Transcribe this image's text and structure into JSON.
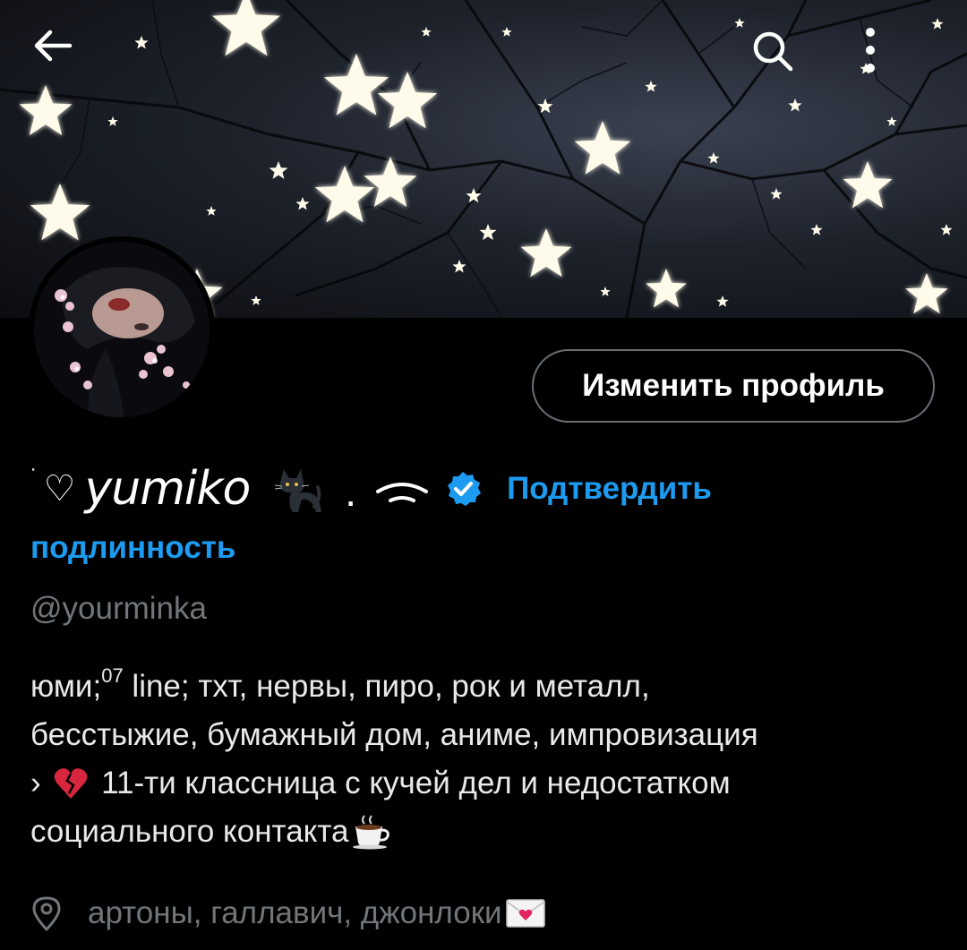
{
  "header": {
    "back_icon": "arrow-left-icon",
    "search_icon": "search-icon",
    "more_icon": "more-vertical-icon"
  },
  "profile": {
    "decor_prefix": "˙",
    "heart": "♡",
    "display_name": "yumiko",
    "name_suffix": ".",
    "handle": "@yourminka",
    "edit_button_label": "Изменить профиль",
    "verify_link_part1": "Подтвердить",
    "verify_link_part2": "подлинность",
    "bio": {
      "line1_a": "юми; ",
      "line1_sup": "07",
      "line1_b": " line; тхт, нервы, пиро, рок и металл,",
      "line2": "бесстыжие, бумажный дом, аниме, импровизация",
      "line3_a": "› ",
      "line3_b": " 11-ти классница с кучей дел и недостатком",
      "line4": "социального контакта"
    },
    "location": "артоны, галлавич, джонлоки"
  },
  "colors": {
    "background": "#000000",
    "link": "#1d9bf0",
    "muted": "#71767b",
    "text": "#e7e9ea",
    "button_border": "#6b6f75"
  }
}
